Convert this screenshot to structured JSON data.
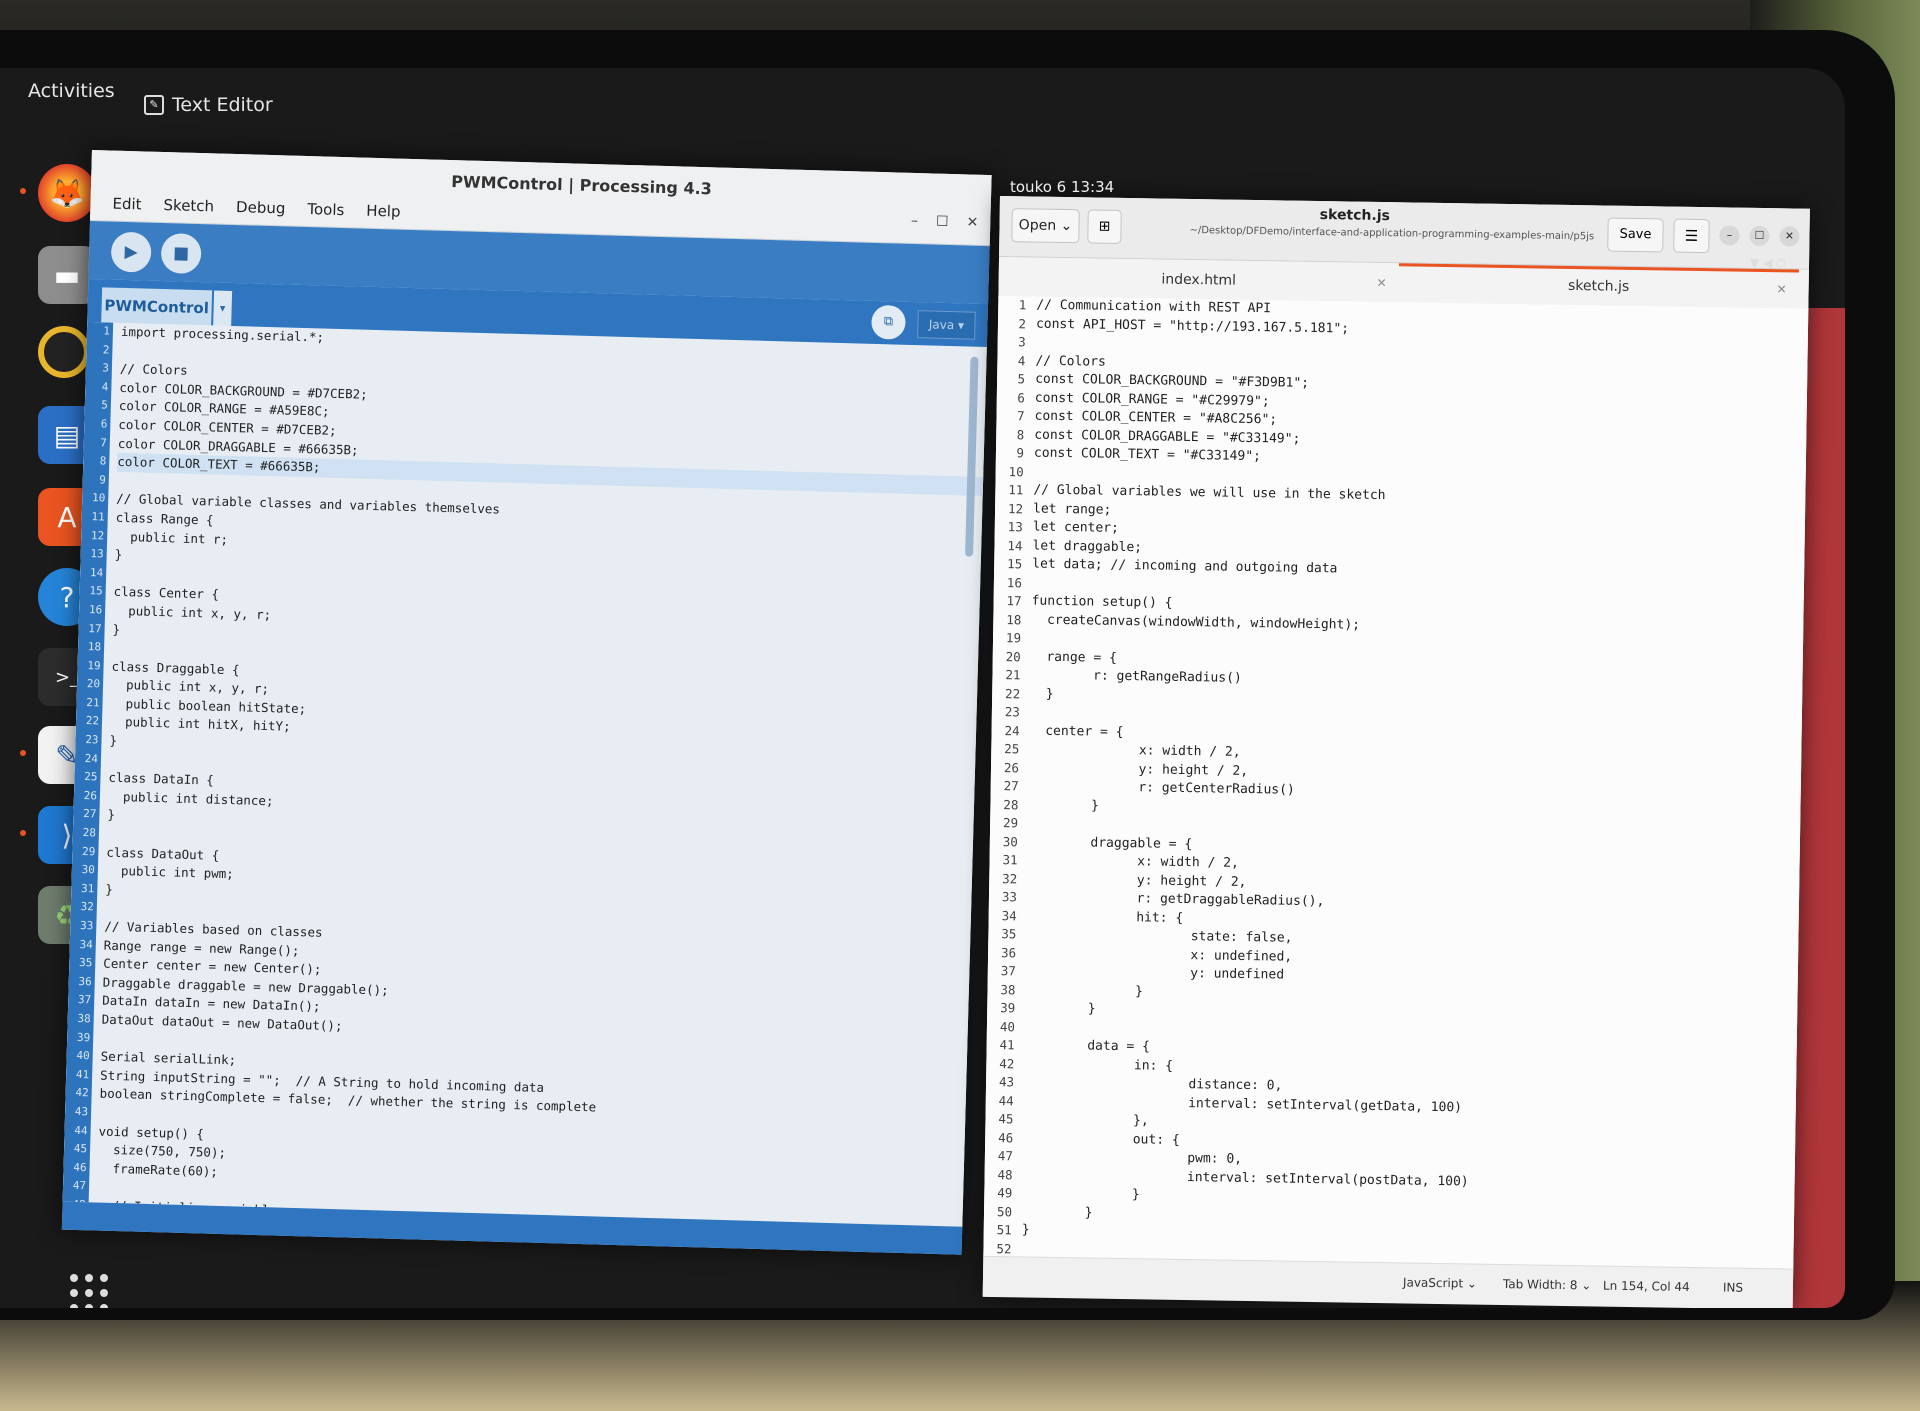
{
  "topbar": {
    "activities": "Activities",
    "app_name": "Text Editor",
    "clock": "touko 6  13:34"
  },
  "dock": {
    "items": [
      "firefox",
      "files",
      "rhythmbox",
      "writer",
      "app-center",
      "help",
      "terminal",
      "text-editor",
      "vscode",
      "trash"
    ],
    "apps_grid_icon": "show-apps-icon"
  },
  "processing": {
    "title": "PWMControl | Processing 4.3",
    "menu": [
      "Edit",
      "Sketch",
      "Debug",
      "Tools",
      "Help"
    ],
    "tab": "PWMControl",
    "mode": "Java ▾",
    "lines": [
      "import processing.serial.*;",
      "",
      "// Colors",
      "color COLOR_BACKGROUND = #D7CEB2;",
      "color COLOR_RANGE = #A59E8C;",
      "color COLOR_CENTER = #D7CEB2;",
      "color COLOR_DRAGGABLE = #66635B;",
      "color COLOR_TEXT = #66635B;",
      "",
      "// Global variable classes and variables themselves",
      "class Range {",
      "  public int r;",
      "}",
      "",
      "class Center {",
      "  public int x, y, r;",
      "}",
      "",
      "class Draggable {",
      "  public int x, y, r;",
      "  public boolean hitState;",
      "  public int hitX, hitY;",
      "}",
      "",
      "class DataIn {",
      "  public int distance;",
      "}",
      "",
      "class DataOut {",
      "  public int pwm;",
      "}",
      "",
      "// Variables based on classes",
      "Range range = new Range();",
      "Center center = new Center();",
      "Draggable draggable = new Draggable();",
      "DataIn dataIn = new DataIn();",
      "DataOut dataOut = new DataOut();",
      "",
      "Serial serialLink;",
      "String inputString = \"\";  // A String to hold incoming data",
      "boolean stringComplete = false;  // whether the string is complete",
      "",
      "void setup() {",
      "  size(750, 750);",
      "  frameRate(60);",
      "",
      "  // Initialize variables"
    ]
  },
  "gedit": {
    "open_label": "Open",
    "title": "sketch.js",
    "path": "~/Desktop/DFDemo/interface-and-application-programming-examples-main/p5js",
    "save_label": "Save",
    "tabs": [
      "index.html",
      "sketch.js"
    ],
    "lines": [
      "// Communication with REST API",
      "const API_HOST = \"http://193.167.5.181\";",
      "",
      "// Colors",
      "const COLOR_BACKGROUND = \"#F3D9B1\";",
      "const COLOR_RANGE = \"#C29979\";",
      "const COLOR_CENTER = \"#A8C256\";",
      "const COLOR_DRAGGABLE = \"#C33149\";",
      "const COLOR_TEXT = \"#C33149\";",
      "",
      "// Global variables we will use in the sketch",
      "let range;",
      "let center;",
      "let draggable;",
      "let data; // incoming and outgoing data",
      "",
      "function setup() {",
      "  createCanvas(windowWidth, windowHeight);",
      "",
      "  range = {",
      "        r: getRangeRadius()",
      "  }",
      "",
      "  center = {",
      "              x: width / 2,",
      "              y: height / 2,",
      "              r: getCenterRadius()",
      "        }",
      "",
      "        draggable = {",
      "              x: width / 2,",
      "              y: height / 2,",
      "              r: getDraggableRadius(),",
      "              hit: {",
      "                     state: false,",
      "                     x: undefined,",
      "                     y: undefined",
      "              }",
      "        }",
      "",
      "        data = {",
      "              in: {",
      "                     distance: 0,",
      "                     interval: setInterval(getData, 100)",
      "              },",
      "              out: {",
      "                     pwm: 0,",
      "                     interval: setInterval(postData, 100)",
      "              }",
      "        }",
      "}",
      ""
    ],
    "status": {
      "language": "JavaScript ⌄",
      "tab_width": "Tab Width: 8 ⌄",
      "position": "Ln 154, Col 44",
      "mode": "INS"
    }
  }
}
